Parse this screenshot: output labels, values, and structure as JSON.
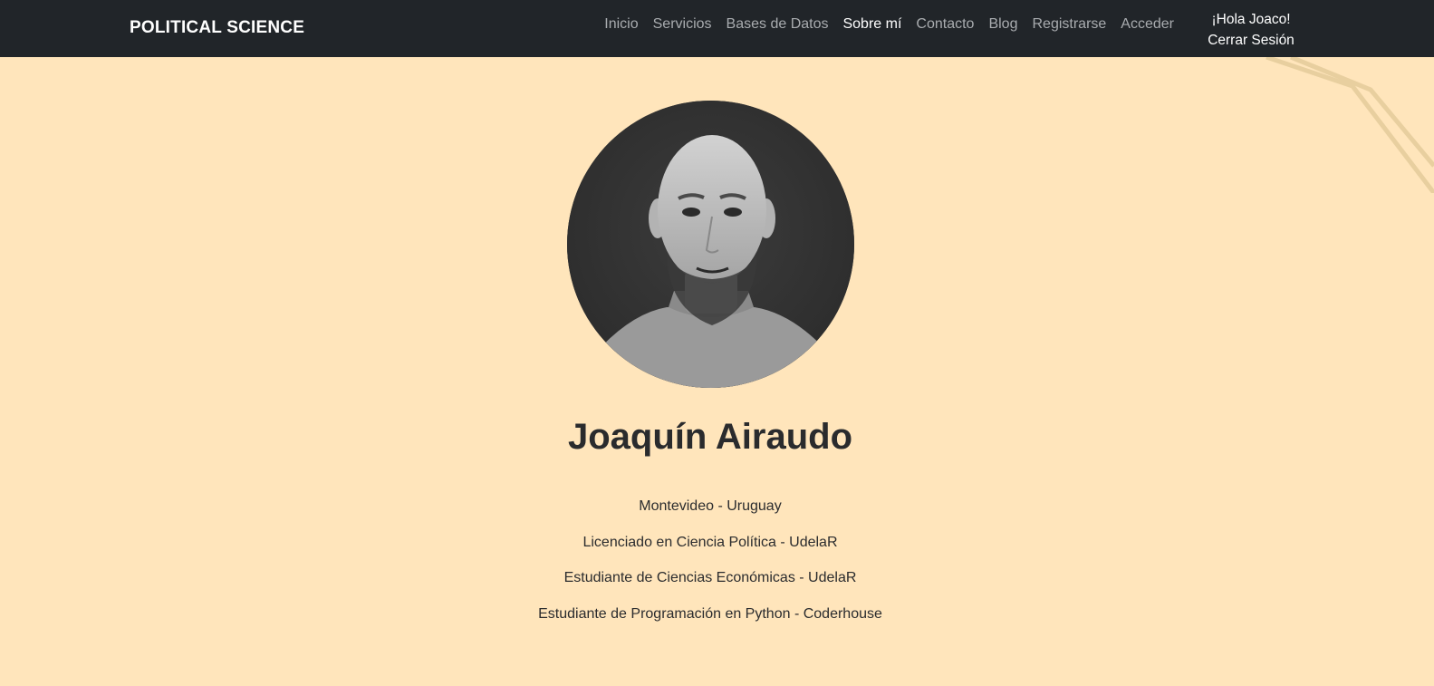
{
  "navbar": {
    "brand": "POLITICAL SCIENCE",
    "links": [
      {
        "label": "Inicio",
        "active": false
      },
      {
        "label": "Servicios",
        "active": false
      },
      {
        "label": "Bases de Datos",
        "active": false
      },
      {
        "label": "Sobre mí",
        "active": true
      },
      {
        "label": "Contacto",
        "active": false
      },
      {
        "label": "Blog",
        "active": false
      },
      {
        "label": "Registrarse",
        "active": false
      },
      {
        "label": "Acceder",
        "active": false
      }
    ],
    "greeting": "¡Hola Joaco!",
    "logout_label": "Cerrar Sesión"
  },
  "profile": {
    "name": "Joaquín Airaudo",
    "details": [
      "Montevideo - Uruguay",
      "Licenciado en Ciencia Política - UdelaR",
      "Estudiante de Ciencias Económicas - UdelaR",
      "Estudiante de Programación en Python - Coderhouse"
    ]
  },
  "colors": {
    "page_background": "#ffe5bb",
    "navbar_background": "#212529",
    "nav_link": "#a9acaf",
    "nav_link_active": "#ffffff"
  }
}
